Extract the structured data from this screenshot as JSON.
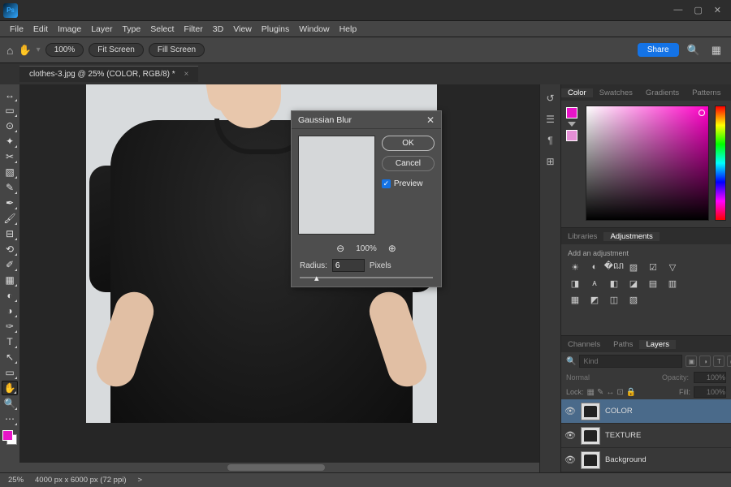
{
  "app": {
    "logo_text": "Ps"
  },
  "window_controls": {
    "min": "—",
    "max": "▢",
    "close": "✕"
  },
  "menu": [
    "File",
    "Edit",
    "Image",
    "Layer",
    "Type",
    "Select",
    "Filter",
    "3D",
    "View",
    "Plugins",
    "Window",
    "Help"
  ],
  "options_bar": {
    "home": "⌂",
    "hand": "✋",
    "zoom_value": "100%",
    "fit_screen": "Fit Screen",
    "fill_screen": "Fill Screen",
    "share": "Share",
    "search": "🔍",
    "arrange": "▦"
  },
  "tab": {
    "label": "clothes-3.jpg @ 25% (COLOR, RGB/8) *",
    "close": "×"
  },
  "tools": [
    {
      "glyph": "↔",
      "name": "move-tool"
    },
    {
      "glyph": "▭",
      "name": "marquee-tool"
    },
    {
      "glyph": "⊙",
      "name": "lasso-tool"
    },
    {
      "glyph": "✦",
      "name": "object-select-tool"
    },
    {
      "glyph": "✂",
      "name": "crop-tool"
    },
    {
      "glyph": "▧",
      "name": "frame-tool"
    },
    {
      "glyph": "✎",
      "name": "eyedropper-tool"
    },
    {
      "glyph": "✒",
      "name": "spot-heal-tool"
    },
    {
      "glyph": "🖌",
      "name": "brush-tool"
    },
    {
      "glyph": "⊟",
      "name": "clone-stamp-tool"
    },
    {
      "glyph": "⟲",
      "name": "history-brush-tool"
    },
    {
      "glyph": "✐",
      "name": "eraser-tool"
    },
    {
      "glyph": "▦",
      "name": "gradient-tool"
    },
    {
      "glyph": "◐",
      "name": "blur-tool"
    },
    {
      "glyph": "◑",
      "name": "dodge-tool"
    },
    {
      "glyph": "✑",
      "name": "pen-tool"
    },
    {
      "glyph": "T",
      "name": "type-tool"
    },
    {
      "glyph": "↖",
      "name": "path-select-tool"
    },
    {
      "glyph": "▭",
      "name": "rectangle-tool"
    },
    {
      "glyph": "✋",
      "name": "hand-tool"
    },
    {
      "glyph": "🔍",
      "name": "zoom-tool"
    },
    {
      "glyph": "⋯",
      "name": "edit-toolbar"
    }
  ],
  "active_tool_index": 19,
  "collapsed": [
    "↺",
    "☰",
    "¶",
    "⊞"
  ],
  "color_tabs": [
    "Color",
    "Swatches",
    "Gradients",
    "Patterns"
  ],
  "color": {
    "fg": "#e815c8",
    "bg": "#ffffff"
  },
  "lib_tabs": [
    "Libraries",
    "Adjustments"
  ],
  "adjustments": {
    "title": "Add an adjustment",
    "row1": [
      "☀",
      "◐",
      "�ណ",
      "▨",
      "☑",
      "▽"
    ],
    "row2": [
      "◨",
      "ᴀ",
      "◧",
      "◪",
      "▤",
      "▥"
    ],
    "row3": [
      "▦",
      "◩",
      "◫",
      "▧"
    ]
  },
  "layer_tabs": [
    "Channels",
    "Paths",
    "Layers"
  ],
  "layers_panel": {
    "search_placeholder": "Kind",
    "filters": [
      "▣",
      "◑",
      "T",
      "▭",
      "◫"
    ],
    "blend_mode": "Normal",
    "opacity_label": "Opacity:",
    "opacity": "100%",
    "lock_label": "Lock:",
    "lock_icons": [
      "▦",
      "✎",
      "↔",
      "⊡",
      "🔒"
    ],
    "fill_label": "Fill:",
    "fill": "100%",
    "layers": [
      {
        "name": "COLOR",
        "visible": true,
        "selected": true
      },
      {
        "name": "TEXTURE",
        "visible": true,
        "selected": false
      },
      {
        "name": "Background",
        "visible": true,
        "selected": false
      }
    ]
  },
  "statusbar": {
    "zoom": "25%",
    "doc": "4000 px x 6000 px (72 ppi)",
    "arrow": ">"
  },
  "dialog": {
    "title": "Gaussian Blur",
    "close": "✕",
    "ok": "OK",
    "cancel": "Cancel",
    "preview": "Preview",
    "preview_checked": true,
    "zoom_out": "⊖",
    "zoom_pct": "100%",
    "zoom_in": "⊕",
    "radius_label": "Radius:",
    "radius_value": "6",
    "radius_unit": "Pixels",
    "knob": "▴"
  }
}
